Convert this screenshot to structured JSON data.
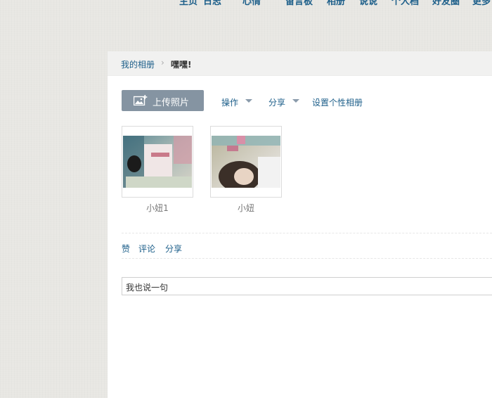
{
  "nav": {
    "items": [
      "主页",
      "日志",
      "心情",
      "留言板",
      "相册",
      "说说",
      "个人档",
      "好友圈",
      "更多"
    ],
    "active": "相册"
  },
  "breadcrumb": {
    "root": "我的相册",
    "current": "嘿嘿!"
  },
  "toolbar": {
    "upload_label": "上传照片",
    "operate_label": "操作",
    "share_label": "分享",
    "customize_label": "设置个性相册"
  },
  "photos": [
    {
      "caption": "小妞1"
    },
    {
      "caption": "小妞"
    }
  ],
  "actions": {
    "like": "赞",
    "comment": "评论",
    "share": "分享"
  },
  "comment": {
    "placeholder": "我也说一句"
  },
  "colors": {
    "link": "#1d5f8a",
    "upload_button": "#8594a2",
    "page_bg": "#e8e7e3"
  }
}
